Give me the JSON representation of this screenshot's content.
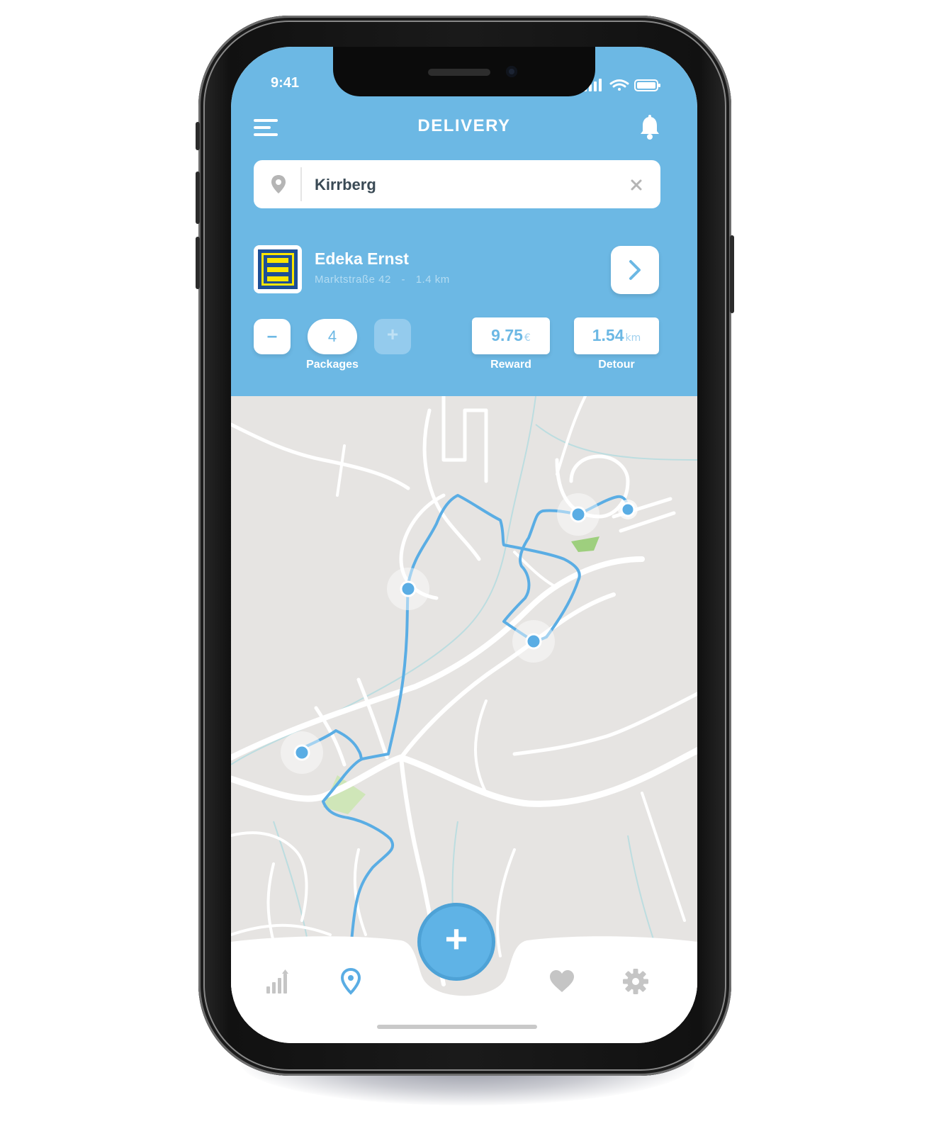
{
  "status_bar": {
    "time": "9:41"
  },
  "header": {
    "title": "DELIVERY",
    "menu_icon": "menu-icon",
    "bell_icon": "bell-icon"
  },
  "search": {
    "value": "Kirrberg",
    "location_icon": "location-pin-icon",
    "clear_icon": "close-icon"
  },
  "store": {
    "name": "Edeka Ernst",
    "address": "Marktstraße 42",
    "separator": "-",
    "distance": "1.4 km",
    "brand_colors": {
      "blue": "#1d4f96",
      "yellow": "#fbe600"
    }
  },
  "packages": {
    "count": "4",
    "label": "Packages",
    "minus_label": "–",
    "plus_label": "+"
  },
  "reward": {
    "value": "9.75",
    "unit": "€",
    "label": "Reward"
  },
  "detour": {
    "value": "1.54",
    "unit": "km",
    "label": "Detour"
  },
  "fab": {
    "label": "+"
  },
  "tabs": [
    {
      "name": "stats",
      "icon": "bar-chart-icon",
      "active": false
    },
    {
      "name": "map",
      "icon": "location-pin-icon",
      "active": true
    },
    {
      "name": "favorites",
      "icon": "heart-icon",
      "active": false
    },
    {
      "name": "settings",
      "icon": "gear-icon",
      "active": false
    }
  ],
  "colors": {
    "accent": "#6cb8e4",
    "route": "#5aade4",
    "map_bg": "#e6e4e2",
    "park": "#cfe6b8",
    "inactive_icon": "#c5c5c5"
  }
}
